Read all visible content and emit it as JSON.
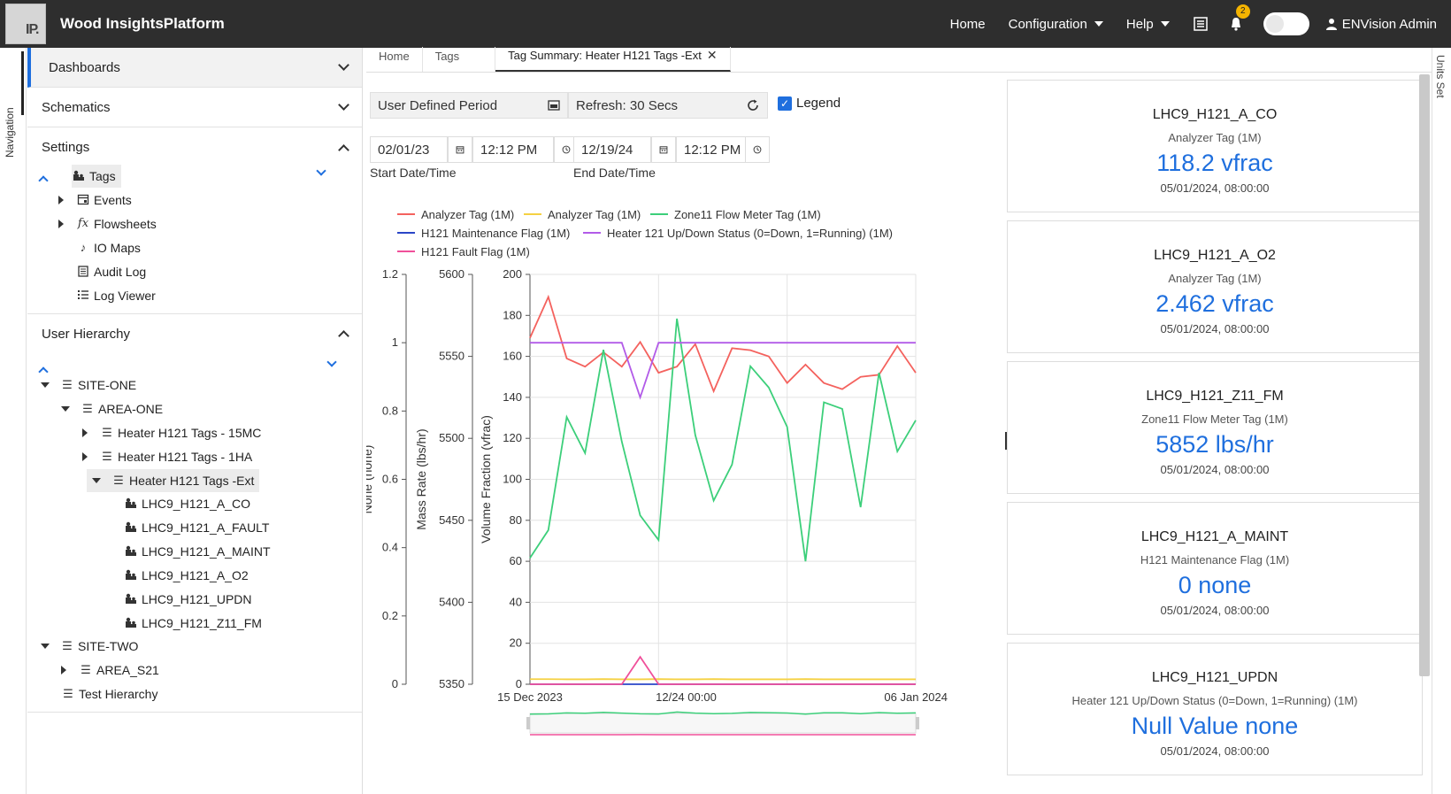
{
  "app": {
    "logo_text": "IP.",
    "title": "Wood InsightsPlatform"
  },
  "topnav": {
    "home": "Home",
    "configuration": "Configuration",
    "help": "Help",
    "notification_count": "2",
    "user": "ENVision Admin"
  },
  "leftstrip": {
    "label": "Navigation"
  },
  "rightstrip": {
    "label": "Units Set"
  },
  "sidebar": {
    "dashboards": "Dashboards",
    "schematics": "Schematics",
    "settings": "Settings",
    "settings_items": [
      "Tags",
      "Events",
      "Flowsheets",
      "IO Maps",
      "Audit Log",
      "Log Viewer"
    ],
    "user_hierarchy": "User Hierarchy",
    "hierarchy": {
      "site_one": "SITE-ONE",
      "area_one": "AREA-ONE",
      "h121_15mc": "Heater H121 Tags - 15MC",
      "h121_1ha": "Heater H121 Tags - 1HA",
      "h121_ext": "Heater H121 Tags -Ext",
      "tags": [
        "LHC9_H121_A_CO",
        "LHC9_H121_A_FAULT",
        "LHC9_H121_A_MAINT",
        "LHC9_H121_A_O2",
        "LHC9_H121_UPDN",
        "LHC9_H121_Z11_FM"
      ],
      "site_two": "SITE-TWO",
      "area_s21": "AREA_S21",
      "test_hierarchy": "Test Hierarchy"
    }
  },
  "tabs": [
    "Home",
    "Tags",
    "Tag Summary: Heater H121 Tags -Ext"
  ],
  "controls": {
    "period": "User Defined Period",
    "refresh": "Refresh: 30 Secs",
    "legend": "Legend",
    "start_date": "02/01/23",
    "start_time": "12:12 PM",
    "end_date": "12/19/24",
    "end_time": "12:12 PM",
    "start_label": "Start Date/Time",
    "end_label": "End Date/Time"
  },
  "chart_data": {
    "type": "line",
    "legend": [
      {
        "name": "Analyzer Tag (1M)",
        "color": "#f4625e"
      },
      {
        "name": "Analyzer Tag (1M)",
        "color": "#f5d142"
      },
      {
        "name": "Zone11 Flow Meter Tag (1M)",
        "color": "#3ccf7a"
      },
      {
        "name": "H121 Maintenance Flag (1M)",
        "color": "#2a46c7"
      },
      {
        "name": "Heater 121 Up/Down Status (0=Down, 1=Running) (1M)",
        "color": "#b25be8"
      },
      {
        "name": "H121 Fault Flag (1M)",
        "color": "#f0509a"
      }
    ],
    "axes": [
      {
        "label": "None (none)",
        "ticks": [
          "1.2",
          "1",
          "0.8",
          "0.6",
          "0.4",
          "0.2",
          "0"
        ],
        "range": [
          0,
          1.2
        ]
      },
      {
        "label": "Mass Rate (lbs/hr)",
        "ticks": [
          "5600",
          "5550",
          "5500",
          "5450",
          "5400",
          "5350"
        ],
        "range": [
          5350,
          5600
        ]
      },
      {
        "label": "Volume Fraction (vfrac)",
        "ticks": [
          "200",
          "180",
          "160",
          "140",
          "120",
          "100",
          "80",
          "60",
          "40",
          "20",
          "0"
        ],
        "range": [
          0,
          200
        ]
      }
    ],
    "x_ticks": [
      "15 Dec 2023",
      "12/24 00:00",
      "06 Jan 2024"
    ],
    "x_range": [
      0,
      21
    ],
    "series": [
      {
        "name": "Analyzer Tag (1M)",
        "color": "#f4625e",
        "axis": 2,
        "values": [
          169,
          189,
          159,
          155,
          162,
          155,
          167,
          152,
          155,
          166,
          143,
          164,
          163,
          160,
          147,
          156,
          147,
          144,
          150,
          151,
          165,
          152
        ]
      },
      {
        "name": "Analyzer Tag (1M)",
        "color": "#f5d142",
        "axis": 2,
        "values": [
          2.5,
          2.5,
          2.4,
          2.4,
          2.5,
          2.4,
          2.4,
          2.5,
          2.4,
          2.4,
          2.5,
          2.4,
          2.4,
          2.4,
          2.4,
          2.5,
          2.4,
          2.4,
          2.4,
          2.4,
          2.4,
          2.4
        ]
      },
      {
        "name": "Zone11 Flow Meter Tag (1M)",
        "color": "#3ccf7a",
        "axis": 1,
        "values": [
          5427,
          5444,
          5513,
          5491,
          5554,
          5498,
          5453,
          5438,
          5573,
          5502,
          5462,
          5484,
          5544,
          5531,
          5507,
          5425,
          5522,
          5518,
          5458,
          5540,
          5492,
          5511
        ]
      },
      {
        "name": "H121 Maintenance Flag (1M)",
        "color": "#2a46c7",
        "axis": 0,
        "values": [
          0,
          0,
          0,
          0,
          0,
          0,
          0,
          0,
          0,
          0,
          0,
          0,
          0,
          0,
          0,
          0,
          0,
          0,
          0,
          0,
          0,
          0
        ]
      },
      {
        "name": "Heater 121 Up/Down Status (0=Down, 1=Running) (1M)",
        "color": "#b25be8",
        "axis": 0,
        "values": [
          1,
          1,
          1,
          1,
          1,
          1,
          0.84,
          1,
          1,
          1,
          1,
          1,
          1,
          1,
          1,
          1,
          1,
          1,
          1,
          1,
          1,
          1
        ]
      },
      {
        "name": "H121 Fault Flag (1M)",
        "color": "#f0509a",
        "axis": 0,
        "values": [
          0,
          0,
          0,
          0,
          0,
          0,
          0.08,
          0,
          0,
          0,
          0,
          0,
          0,
          0,
          0,
          0,
          0,
          0,
          0,
          0,
          0,
          0
        ]
      }
    ]
  },
  "cards": [
    {
      "name": "LHC9_H121_A_CO",
      "desc": "Analyzer Tag (1M)",
      "value": "118.2 vfrac",
      "time": "05/01/2024, 08:00:00"
    },
    {
      "name": "LHC9_H121_A_O2",
      "desc": "Analyzer Tag (1M)",
      "value": "2.462 vfrac",
      "time": "05/01/2024, 08:00:00"
    },
    {
      "name": "LHC9_H121_Z11_FM",
      "desc": "Zone11 Flow Meter Tag (1M)",
      "value": "5852 lbs/hr",
      "time": "05/01/2024, 08:00:00"
    },
    {
      "name": "LHC9_H121_A_MAINT",
      "desc": "H121 Maintenance Flag (1M)",
      "value": "0 none",
      "time": "05/01/2024, 08:00:00"
    },
    {
      "name": "LHC9_H121_UPDN",
      "desc": "Heater 121 Up/Down Status (0=Down, 1=Running) (1M)",
      "value": "Null Value none",
      "time": "05/01/2024, 08:00:00"
    }
  ]
}
